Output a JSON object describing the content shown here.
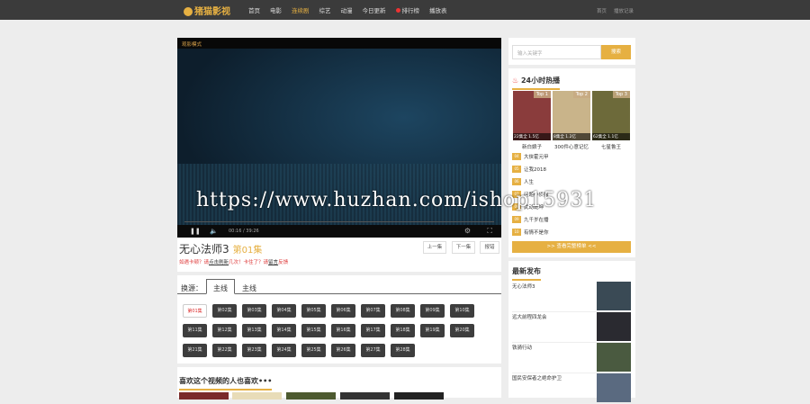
{
  "header": {
    "logo": "猪猫影视",
    "nav": [
      "首页",
      "电影",
      "连续剧",
      "综艺",
      "动漫",
      "今日更新",
      "排行榜",
      "播放表"
    ],
    "active": 2,
    "right": [
      "首页",
      "播放记录"
    ]
  },
  "player": {
    "mode": "观影模式",
    "time": "00:16 / 39:26",
    "watermark": "https://www.huzhan.com/ishop15931",
    "progress": 0.007
  },
  "video": {
    "title": "无心法师3",
    "episode": "第01集",
    "tip_a": "如遇卡顿？请",
    "tip_link1": "点击刷新",
    "tip_b": "几次！卡住了？请",
    "tip_link2": "留言",
    "tip_c": "反馈",
    "prev": "上一集",
    "next": "下一集",
    "report": "报错"
  },
  "source": {
    "label": "换源：",
    "tabs": [
      "主线",
      "主线"
    ]
  },
  "episodes": [
    "第01集",
    "第02集",
    "第03集",
    "第04集",
    "第05集",
    "第06集",
    "第07集",
    "第08集",
    "第09集",
    "第10集",
    "第11集",
    "第12集",
    "第13集",
    "第14集",
    "第15集",
    "第16集",
    "第17集",
    "第18集",
    "第19集",
    "第20集",
    "第21集",
    "第22集",
    "第23集",
    "第24集",
    "第25集",
    "第26集",
    "第27集",
    "第28集"
  ],
  "like": {
    "title": "喜欢这个视频的人也喜欢•••"
  },
  "sidebar": {
    "search": {
      "placeholder": "输入关键字",
      "button": "搜索"
    },
    "hot": {
      "title": "24小时热播",
      "top": [
        {
          "tag": "Top 1",
          "info": "22集全 1.5亿",
          "name": "新白娘子"
        },
        {
          "tag": "Top 2",
          "info": "8集全 1.2亿",
          "name": "300件心意记忆"
        },
        {
          "tag": "Top 3",
          "info": "62集全 1.1亿",
          "name": "七星鲁王"
        }
      ],
      "list": [
        {
          "n": "04",
          "t": "大侠霍元甲"
        },
        {
          "n": "05",
          "t": "让我2018"
        },
        {
          "n": "06",
          "t": "人生"
        },
        {
          "n": "07",
          "t": "问题小侦探"
        },
        {
          "n": "08",
          "t": "武动乾坤"
        },
        {
          "n": "09",
          "t": "九千岁在播"
        },
        {
          "n": "10",
          "t": "有情不是你"
        }
      ],
      "more": ">> 查看完整榜单 <<"
    },
    "latest": {
      "title": "最新发布",
      "items": [
        "无心法师3",
        "远大前程四龙会",
        "铁骑行动",
        "国民安保者之绝命护卫"
      ]
    }
  }
}
